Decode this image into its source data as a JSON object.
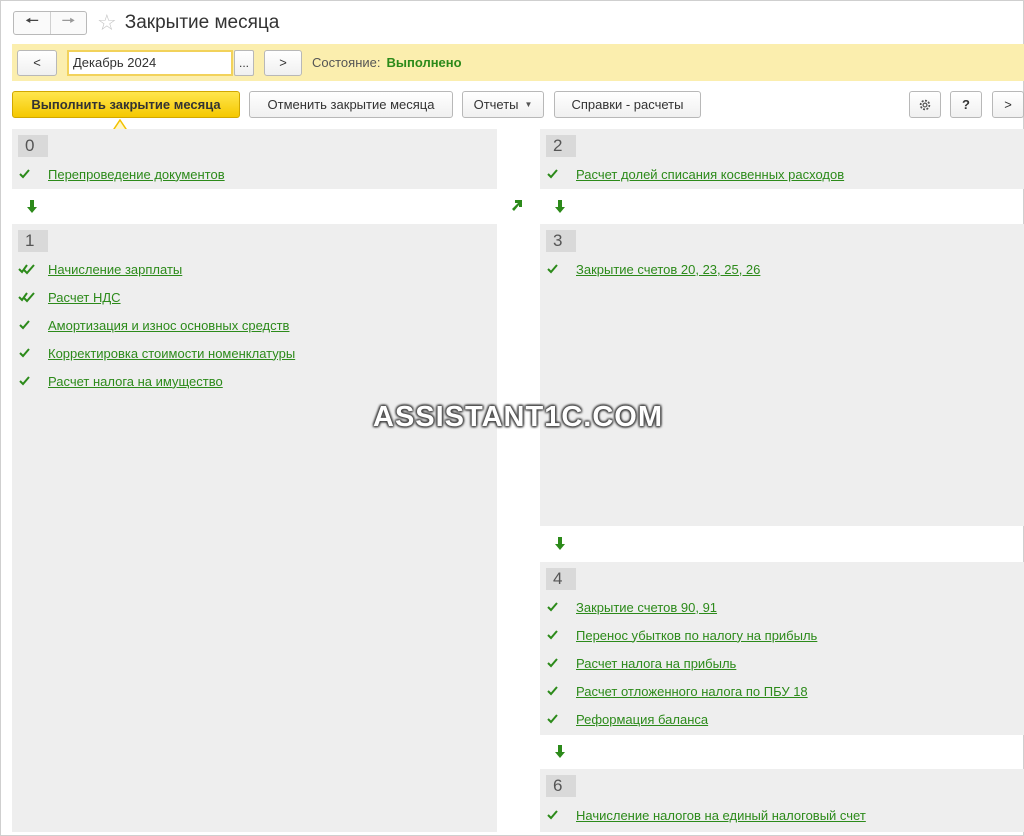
{
  "window": {
    "title": "Закрытие месяца",
    "back_icon": "arrow-left-icon",
    "forward_icon": "arrow-right-icon",
    "favorite_icon": "star-icon"
  },
  "period": {
    "prev_label": "<",
    "value": "Декабрь 2024",
    "dots_label": "...",
    "next_label": ">",
    "status_label": "Состояние:",
    "status_value": "Выполнено"
  },
  "toolbar": {
    "execute_label": "Выполнить закрытие месяца",
    "cancel_label": "Отменить закрытие месяца",
    "reports_label": "Отчеты",
    "refs_label": "Справки - расчеты",
    "help_label": "?",
    "more_label": ">"
  },
  "stages": [
    {
      "number": "0",
      "items": [
        "Перепроведение документов"
      ]
    },
    {
      "number": "1",
      "items": [
        "Начисление зарплаты",
        "Расчет НДС",
        "Амортизация и износ основных средств",
        "Корректировка стоимости номенклатуры",
        "Расчет налога на имущество"
      ]
    },
    {
      "number": "2",
      "items": [
        "Расчет долей списания косвенных расходов"
      ]
    },
    {
      "number": "3",
      "items": [
        "Закрытие счетов 20, 23, 25, 26"
      ]
    },
    {
      "number": "4",
      "items": [
        "Закрытие счетов 90, 91",
        "Перенос убытков по налогу на прибыль",
        "Расчет налога на прибыль",
        "Расчет отложенного налога по ПБУ 18",
        "Реформация баланса"
      ]
    },
    {
      "number": "6",
      "items": [
        "Начисление налогов на единый налоговый счет"
      ]
    }
  ],
  "watermark": "ASSISTANT1C.COM",
  "colors": {
    "accent_yellow": "#f5c800",
    "period_bar": "#fbeeae",
    "link_green": "#2c8a1a",
    "panel_bg": "#eeeeee"
  }
}
